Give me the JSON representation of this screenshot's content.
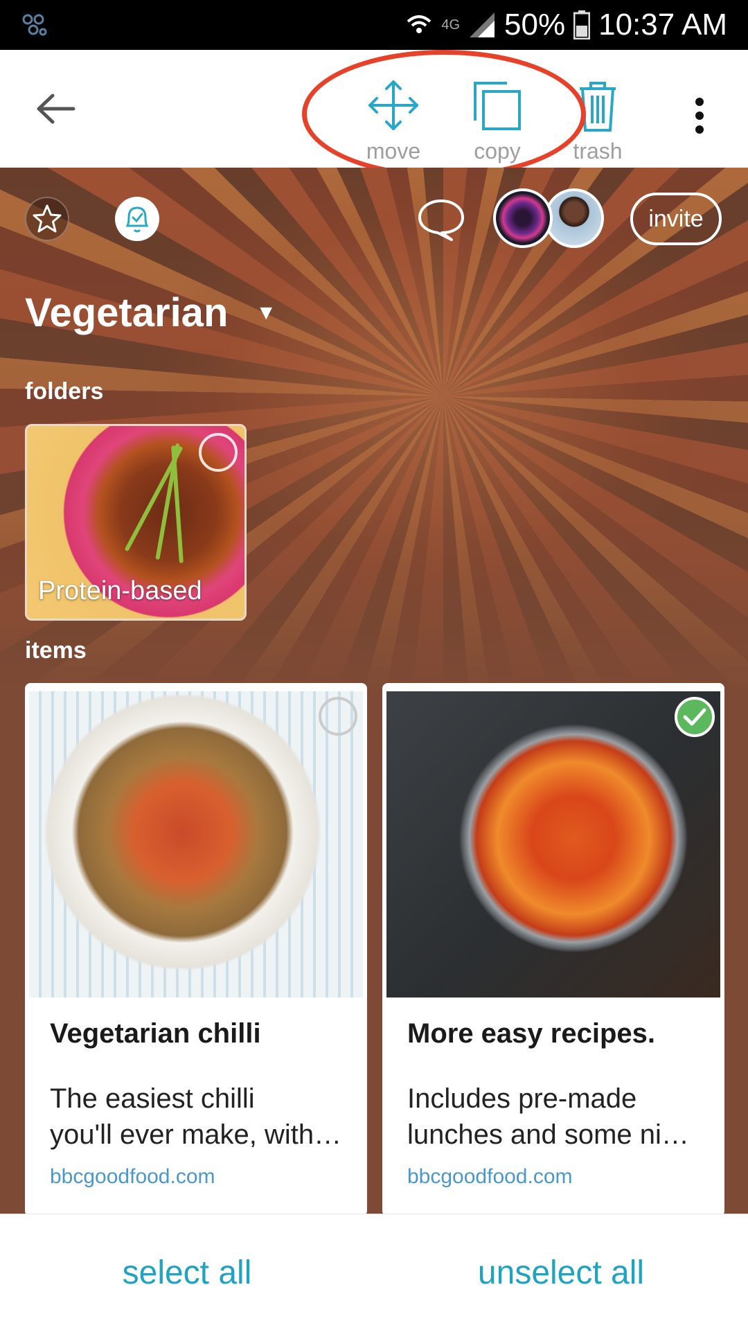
{
  "status_bar": {
    "network": "4G",
    "battery": "50%",
    "time": "10:37 AM",
    "icons": [
      "app-notification-icon",
      "wifi-icon",
      "signal-icon",
      "battery-icon"
    ]
  },
  "toolbar": {
    "back_icon": "arrow-left-icon",
    "move_label": "move",
    "copy_label": "copy",
    "trash_label": "trash",
    "more_icon": "more-vertical-icon",
    "highlight_color": "#e8412a",
    "icon_color": "#29a8c6"
  },
  "header": {
    "star_icon": "star-icon",
    "reminder_icon": "bell-check-icon",
    "chat_icon": "chat-bubble-icon",
    "invite_label": "invite",
    "title": "Vegetarian",
    "title_caret": "▼"
  },
  "folders": {
    "label": "folders",
    "items": [
      {
        "label": "Protein-based",
        "selected": false
      }
    ]
  },
  "items": {
    "label": "items",
    "cards": [
      {
        "title": "Vegetarian chilli",
        "desc_line1": "The easiest chilli",
        "desc_line2": "you'll ever make, with…",
        "source": "bbcgoodfood.com",
        "selected": false
      },
      {
        "title": "More easy recipes.",
        "desc_line1": "Includes pre-made",
        "desc_line2": "lunches and some ni…",
        "source": "bbcgoodfood.com",
        "selected": true
      }
    ]
  },
  "bottom_bar": {
    "select_all_label": "select all",
    "unselect_all_label": "unselect all",
    "accent_color": "#1ea3c1"
  }
}
